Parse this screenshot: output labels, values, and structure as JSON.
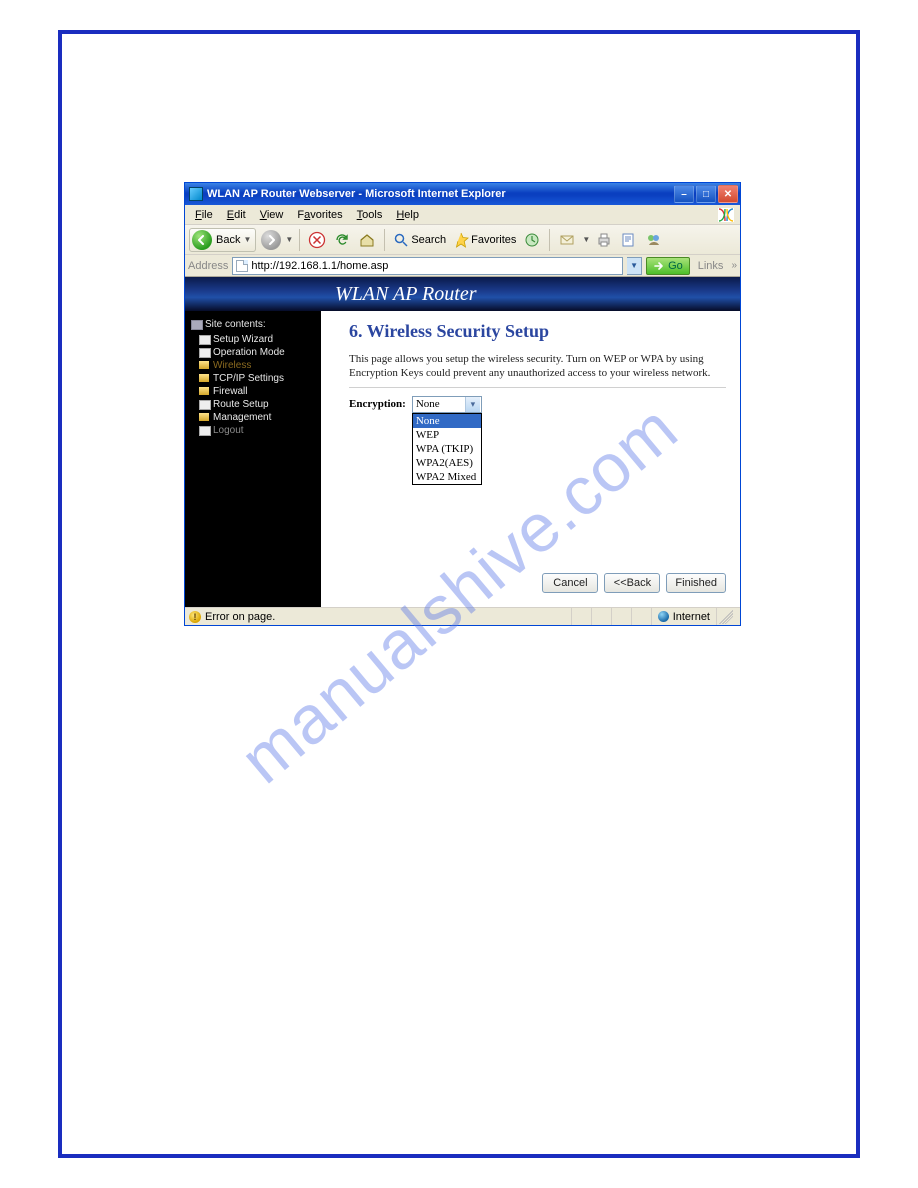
{
  "window": {
    "title": "WLAN AP Router Webserver - Microsoft Internet Explorer"
  },
  "menus": {
    "file": "File",
    "edit": "Edit",
    "view": "View",
    "favorites": "Favorites",
    "tools": "Tools",
    "help": "Help"
  },
  "toolbar": {
    "back": "Back",
    "search": "Search",
    "favorites": "Favorites"
  },
  "address": {
    "label": "Address",
    "url": "http://192.168.1.1/home.asp",
    "go": "Go",
    "links": "Links"
  },
  "banner": {
    "title": "WLAN AP Router"
  },
  "sidebar": {
    "header": "Site contents:",
    "items": [
      {
        "label": "Setup Wizard",
        "kind": "page",
        "state": ""
      },
      {
        "label": "Operation Mode",
        "kind": "page",
        "state": ""
      },
      {
        "label": "Wireless",
        "kind": "folder",
        "state": "active"
      },
      {
        "label": "TCP/IP Settings",
        "kind": "folder",
        "state": ""
      },
      {
        "label": "Firewall",
        "kind": "folder",
        "state": ""
      },
      {
        "label": "Route Setup",
        "kind": "page",
        "state": ""
      },
      {
        "label": "Management",
        "kind": "folder",
        "state": ""
      },
      {
        "label": "Logout",
        "kind": "page",
        "state": "dim"
      }
    ]
  },
  "page": {
    "heading": "6. Wireless Security Setup",
    "description": "This page allows you setup the wireless security. Turn on WEP or WPA by using Encryption Keys could prevent any unauthorized access to your wireless network.",
    "encryption_label": "Encryption:",
    "encryption_selected": "None",
    "encryption_options": [
      "None",
      "WEP",
      "WPA (TKIP)",
      "WPA2(AES)",
      "WPA2 Mixed"
    ],
    "buttons": {
      "cancel": "Cancel",
      "back": "<<Back",
      "finished": "Finished"
    }
  },
  "status": {
    "left": "Error on page.",
    "zone": "Internet"
  },
  "watermark": "manualshive.com"
}
